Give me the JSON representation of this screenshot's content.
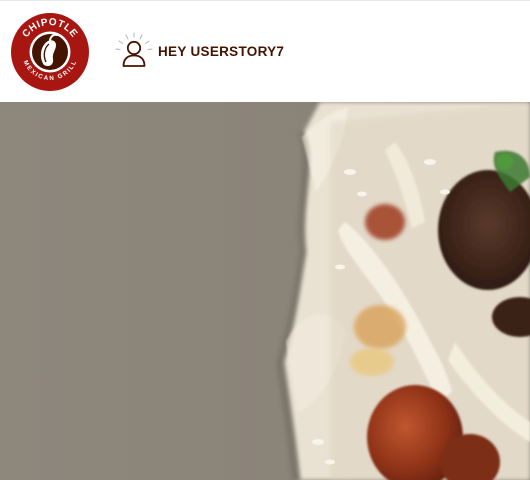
{
  "brand": {
    "name_top": "CHIPOTLE",
    "name_bottom": "MEXICAN GRILL",
    "logo_color": "#a81612"
  },
  "header": {
    "greeting": "HEY USERSTORY7",
    "user_icon": "user-icon",
    "text_color": "#451400"
  },
  "hero": {
    "image": "burrito-closeup-photo"
  }
}
